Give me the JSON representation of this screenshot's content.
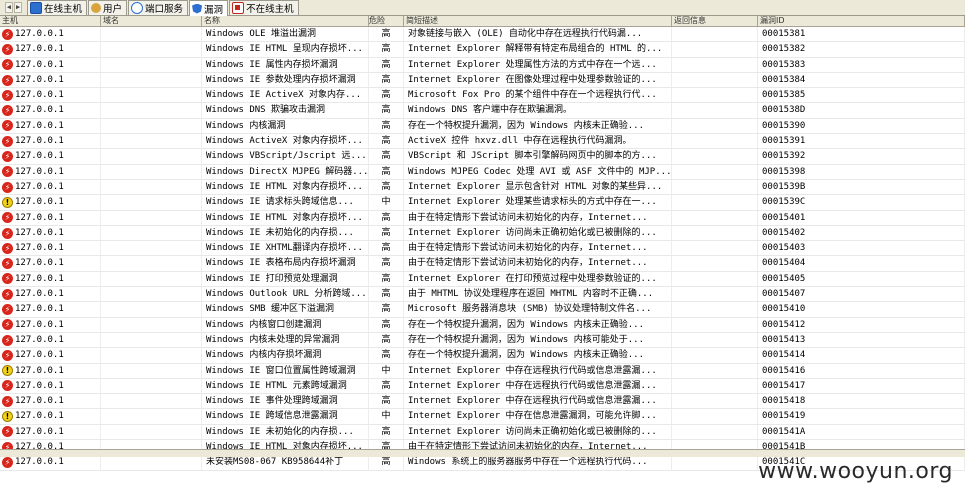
{
  "tabs": [
    {
      "label": "在线主机",
      "icon": "host-icon"
    },
    {
      "label": "用户",
      "icon": "user-icon"
    },
    {
      "label": "端口服务",
      "icon": "port-icon"
    },
    {
      "label": "漏洞",
      "icon": "vuln-shield-icon",
      "active": true
    },
    {
      "label": "不在线主机",
      "icon": "offline-host-icon"
    }
  ],
  "columns": [
    "主机",
    "域名",
    "名称",
    "危险",
    "简短描述",
    "返回信息",
    "漏洞ID"
  ],
  "rows": [
    {
      "sev": "high",
      "host": "127.0.0.1",
      "name": "Windows OLE 堆溢出漏洞",
      "risk": "高",
      "desc": "对象链接与嵌入 (OLE) 自动化中存在远程执行代码漏...",
      "id": "00015381"
    },
    {
      "sev": "high",
      "host": "127.0.0.1",
      "name": "Windows IE HTML 呈现内存损坏...",
      "risk": "高",
      "desc": "Internet Explorer 解释带有特定布局组合的 HTML 的...",
      "id": "00015382"
    },
    {
      "sev": "high",
      "host": "127.0.0.1",
      "name": "Windows IE 属性内存损坏漏洞",
      "risk": "高",
      "desc": "Internet Explorer 处理属性方法的方式中存在一个远...",
      "id": "00015383"
    },
    {
      "sev": "high",
      "host": "127.0.0.1",
      "name": "Windows IE 参数处理内存损坏漏洞",
      "risk": "高",
      "desc": "Internet Explorer 在图像处理过程中处理参数验证的...",
      "id": "00015384"
    },
    {
      "sev": "high",
      "host": "127.0.0.1",
      "name": "Windows IE ActiveX 对象内存...",
      "risk": "高",
      "desc": "Microsoft Fox Pro 的某个组件中存在一个远程执行代...",
      "id": "00015385"
    },
    {
      "sev": "high",
      "host": "127.0.0.1",
      "name": "Windows DNS 欺骗攻击漏洞",
      "risk": "高",
      "desc": "Windows DNS 客户端中存在欺骗漏洞。",
      "id": "0001538D"
    },
    {
      "sev": "high",
      "host": "127.0.0.1",
      "name": "Windows 内核漏洞",
      "risk": "高",
      "desc": "存在一个特权提升漏洞，因为 Windows 内核未正确验...",
      "id": "00015390"
    },
    {
      "sev": "high",
      "host": "127.0.0.1",
      "name": "Windows ActiveX 对象内存损坏...",
      "risk": "高",
      "desc": "ActiveX 控件 hxvz.dll 中存在远程执行代码漏洞。",
      "id": "00015391"
    },
    {
      "sev": "high",
      "host": "127.0.0.1",
      "name": "Windows VBScript/Jscript 远...",
      "risk": "高",
      "desc": "VBScript 和 JScript 脚本引擎解码网页中的脚本的方...",
      "id": "00015392"
    },
    {
      "sev": "high",
      "host": "127.0.0.1",
      "name": "Windows DirectX MJPEG 解码器...",
      "risk": "高",
      "desc": "Windows MJPEG Codec 处理 AVI 或 ASF 文件中的 MJP...",
      "id": "00015398"
    },
    {
      "sev": "high",
      "host": "127.0.0.1",
      "name": "Windows IE HTML 对象内存损坏...",
      "risk": "高",
      "desc": "Internet Explorer 显示包含针对 HTML 对象的某些异...",
      "id": "0001539B"
    },
    {
      "sev": "mid",
      "host": "127.0.0.1",
      "name": "Windows IE 请求标头跨域信息...",
      "risk": "中",
      "desc": "Internet Explorer 处理某些请求标头的方式中存在一...",
      "id": "0001539C"
    },
    {
      "sev": "high",
      "host": "127.0.0.1",
      "name": "Windows IE HTML 对象内存损坏...",
      "risk": "高",
      "desc": "由于在特定情形下尝试访问未初始化的内存，Internet...",
      "id": "00015401"
    },
    {
      "sev": "high",
      "host": "127.0.0.1",
      "name": "Windows IE 未初始化的内存损...",
      "risk": "高",
      "desc": "Internet Explorer 访问尚未正确初始化或已被删除的...",
      "id": "00015402"
    },
    {
      "sev": "high",
      "host": "127.0.0.1",
      "name": "Windows IE XHTML翻译内存损坏...",
      "risk": "高",
      "desc": "由于在特定情形下尝试访问未初始化的内存，Internet...",
      "id": "00015403"
    },
    {
      "sev": "high",
      "host": "127.0.0.1",
      "name": "Windows IE 表格布局内存损坏漏洞",
      "risk": "高",
      "desc": "由于在特定情形下尝试访问未初始化的内存，Internet...",
      "id": "00015404"
    },
    {
      "sev": "high",
      "host": "127.0.0.1",
      "name": "Windows IE 打印预览处理漏洞",
      "risk": "高",
      "desc": "Internet Explorer 在打印预览过程中处理参数验证的...",
      "id": "00015405"
    },
    {
      "sev": "high",
      "host": "127.0.0.1",
      "name": "Windows Outlook URL 分析跨域...",
      "risk": "高",
      "desc": "由于 MHTML 协议处理程序在返回 MHTML 内容时不正确...",
      "id": "00015407"
    },
    {
      "sev": "high",
      "host": "127.0.0.1",
      "name": "Windows SMB 缓冲区下溢漏洞",
      "risk": "高",
      "desc": "Microsoft 服务器消息块 (SMB) 协议处理特制文件名...",
      "id": "00015410"
    },
    {
      "sev": "high",
      "host": "127.0.0.1",
      "name": "Windows 内核窗口创建漏洞",
      "risk": "高",
      "desc": "存在一个特权提升漏洞，因为 Windows 内核未正确验...",
      "id": "00015412"
    },
    {
      "sev": "high",
      "host": "127.0.0.1",
      "name": "Windows 内核未处理的异常漏洞",
      "risk": "高",
      "desc": "存在一个特权提升漏洞，因为 Windows 内核可能处于...",
      "id": "00015413"
    },
    {
      "sev": "high",
      "host": "127.0.0.1",
      "name": "Windows 内核内存损坏漏洞",
      "risk": "高",
      "desc": "存在一个特权提升漏洞，因为 Windows 内核未正确验...",
      "id": "00015414"
    },
    {
      "sev": "mid",
      "host": "127.0.0.1",
      "name": "Windows IE 窗口位置属性跨域漏洞",
      "risk": "中",
      "desc": "Internet Explorer 中存在远程执行代码或信息泄露漏...",
      "id": "00015416"
    },
    {
      "sev": "high",
      "host": "127.0.0.1",
      "name": "Windows IE HTML 元素跨域漏洞",
      "risk": "高",
      "desc": "Internet Explorer 中存在远程执行代码或信息泄露漏...",
      "id": "00015417"
    },
    {
      "sev": "high",
      "host": "127.0.0.1",
      "name": "Windows IE 事件处理跨域漏洞",
      "risk": "高",
      "desc": "Internet Explorer 中存在远程执行代码或信息泄露漏...",
      "id": "00015418"
    },
    {
      "sev": "mid",
      "host": "127.0.0.1",
      "name": "Windows IE 跨域信息泄露漏洞",
      "risk": "中",
      "desc": "Internet Explorer 中存在信息泄露漏洞，可能允许脚...",
      "id": "00015419"
    },
    {
      "sev": "high",
      "host": "127.0.0.1",
      "name": "Windows IE 未初始化的内存损...",
      "risk": "高",
      "desc": "Internet Explorer 访问尚未正确初始化或已被删除的...",
      "id": "0001541A"
    },
    {
      "sev": "high",
      "host": "127.0.0.1",
      "name": "Windows IE HTML 对象内存损坏...",
      "risk": "高",
      "desc": "由于在特定情形下尝试访问未初始化的内存，Internet...",
      "id": "0001541B"
    },
    {
      "sev": "high",
      "host": "127.0.0.1",
      "name": "未安装MS08-067 KB958644补丁",
      "risk": "高",
      "desc": "Windows 系统上的服务器服务中存在一个远程执行代码...",
      "id": "0001541C"
    }
  ],
  "watermark": "www.wooyun.org"
}
